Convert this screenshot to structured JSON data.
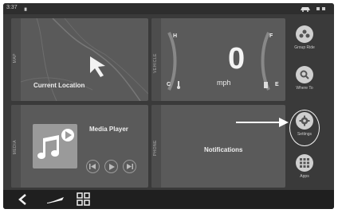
{
  "status": {
    "time": "3:37",
    "signal": "▗",
    "right_icons": [
      "car-icon",
      "battery-icon"
    ]
  },
  "tiles": {
    "map": {
      "side_label": "MAP",
      "caption": "Current Location"
    },
    "vehicle": {
      "side_label": "VEHICLE",
      "speed": "0",
      "unit": "mph",
      "gauge_left_top": "H",
      "gauge_left_bottom": "C",
      "gauge_right_top": "F",
      "gauge_right_bottom": "E"
    },
    "media": {
      "side_label": "MEDIA",
      "title": "Media Player"
    },
    "phone": {
      "side_label": "PHONE",
      "caption": "Notifications"
    }
  },
  "sidebar": [
    {
      "label": "Group Ride",
      "icon": "group-ride-icon"
    },
    {
      "label": "Where To",
      "icon": "search-icon"
    },
    {
      "label": "Settings",
      "icon": "gear-icon"
    },
    {
      "label": "Apps",
      "icon": "apps-grid-icon"
    }
  ],
  "navbar": {
    "icons": [
      "back-icon",
      "home-icon",
      "grid-icon"
    ]
  },
  "colors": {
    "background": "#3a3a3a",
    "tile": "#5a5a5a",
    "navbar": "#1f1f1f",
    "accent": "#ffffff"
  }
}
